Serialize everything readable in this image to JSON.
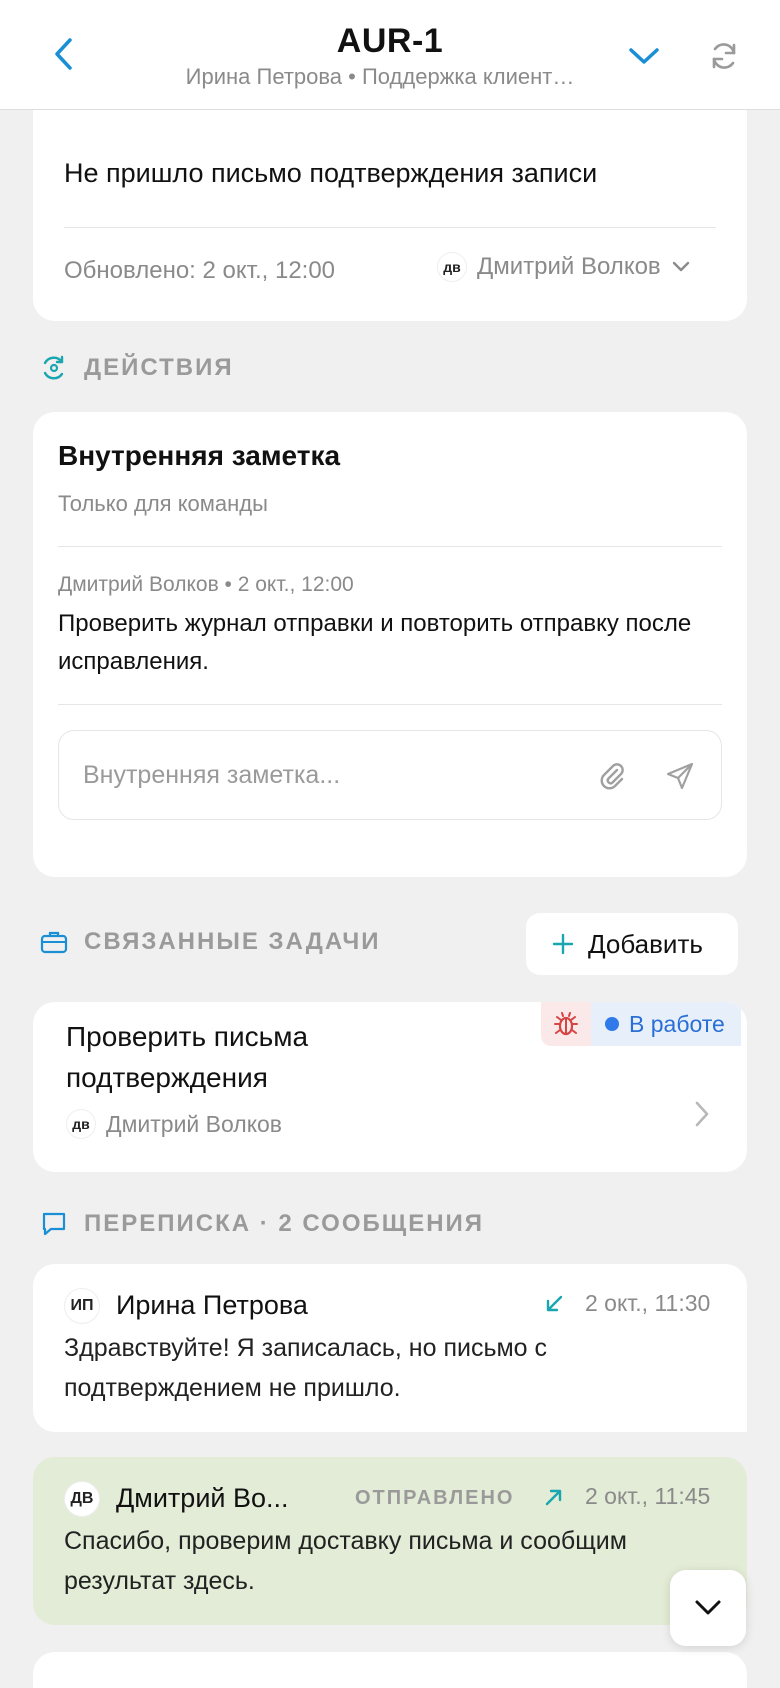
{
  "header": {
    "title": "AUR-1",
    "subtitle": "Ирина Петрова • Поддержка клиент…"
  },
  "ticket": {
    "subject": "Не пришло письмо подтверждения записи",
    "updated": "Обновлено: 2 окт., 12:00",
    "assignee_initials": "дв",
    "assignee_name": "Дмитрий Волков"
  },
  "actions": {
    "label": "ДЕЙСТВИЯ",
    "note_title": "Внутренняя заметка",
    "note_subtitle": "Только для команды",
    "note_meta": "Дмитрий Волков • 2 окт., 12:00",
    "note_text": "Проверить журнал отправки и повторить отправку после исправления.",
    "input_placeholder": "Внутренняя заметка..."
  },
  "related": {
    "label": "СВЯЗАННЫЕ ЗАДАЧИ",
    "add_label": "Добавить",
    "task": {
      "title": "Проверить письма подтверждения",
      "status": "В работе",
      "assignee_initials": "дв",
      "assignee_name": "Дмитрий Волков"
    }
  },
  "conversation": {
    "label": "ПЕРЕПИСКА · 2 СООБЩЕНИЯ",
    "messages": [
      {
        "initials": "ИП",
        "author": "Ирина Петрова",
        "time": "2 окт., 11:30",
        "text": "Здравствуйте! Я записалась, но письмо с подтверждением не пришло."
      },
      {
        "initials": "ДВ",
        "author": "Дмитрий Во...",
        "status": "ОТПРАВЛЕНО",
        "time": "2 окт., 11:45",
        "text": "Спасибо, проверим доставку письма и сообщим результат здесь."
      }
    ]
  },
  "colors": {
    "accent": "#1a8fd6",
    "teal": "#1aa6b0",
    "status_blue": "#2f7ae8",
    "bug_red": "#d64545",
    "outgoing_bg": "#e3ecd6"
  }
}
